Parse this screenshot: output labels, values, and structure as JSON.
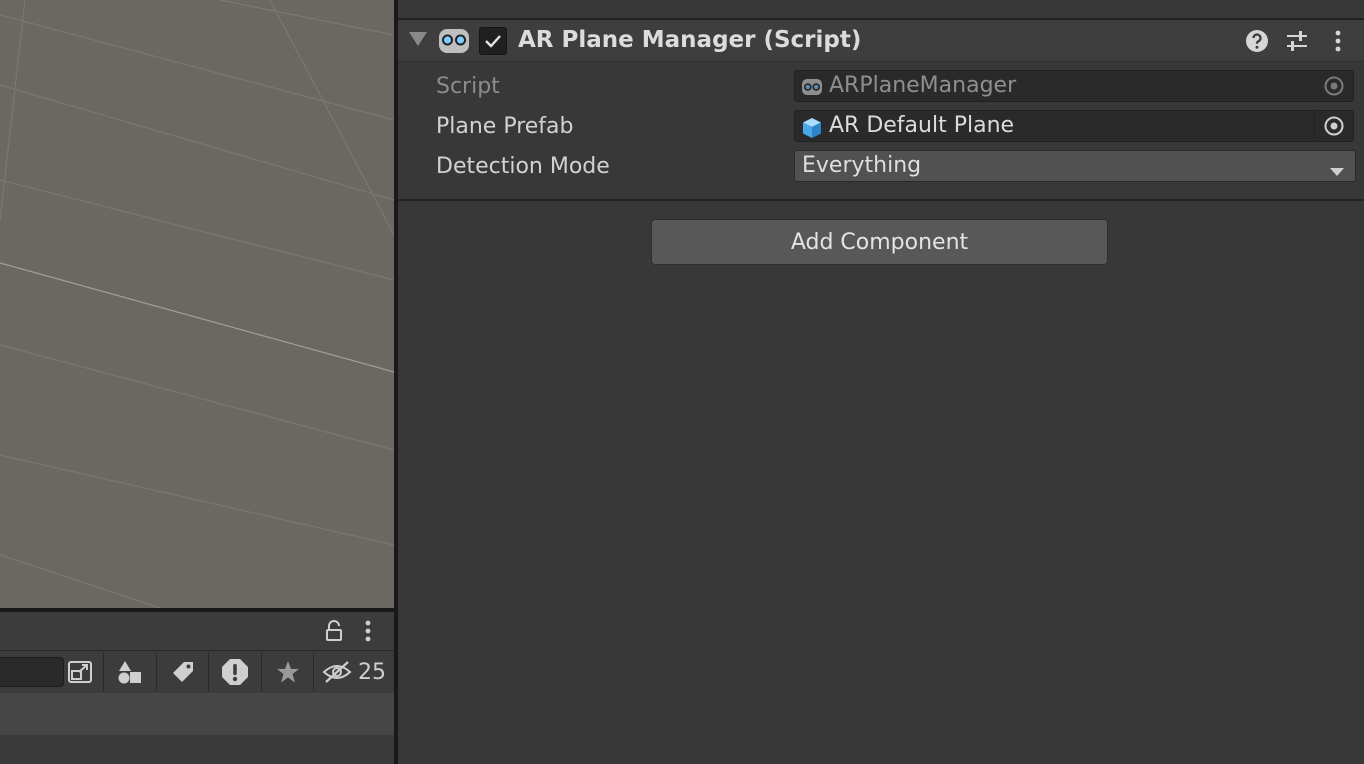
{
  "component": {
    "title": "AR Plane Manager (Script)",
    "enabled": true,
    "icon": "ar-script-goggles-icon",
    "header_icons": [
      "help-icon",
      "preset-sliders-icon",
      "kebab-menu-icon"
    ]
  },
  "properties": {
    "script": {
      "label": "Script",
      "value": "ARPlaneManager",
      "icon": "script-goggles-icon"
    },
    "plane_prefab": {
      "label": "Plane Prefab",
      "value": "AR Default Plane",
      "icon": "prefab-cube-icon"
    },
    "detection_mode": {
      "label": "Detection Mode",
      "value": "Everything"
    }
  },
  "add_component": {
    "label": "Add Component"
  },
  "project_panel": {
    "header_icons": [
      "lock-icon",
      "kebab-menu-icon"
    ],
    "toolbar_icons": [
      "scene-search-icon",
      "filter-by-type-icon",
      "filter-by-label-icon",
      "warning-icon",
      "favorite-star-icon",
      "hidden-eye-icon"
    ],
    "hidden_count": "25"
  },
  "colors": {
    "scene_bg": "#6b6863",
    "inspector_bg": "#383838",
    "field_bg": "#2a2a2a",
    "button_bg": "#585858",
    "accent_icon_blue": "#7ecbff"
  }
}
